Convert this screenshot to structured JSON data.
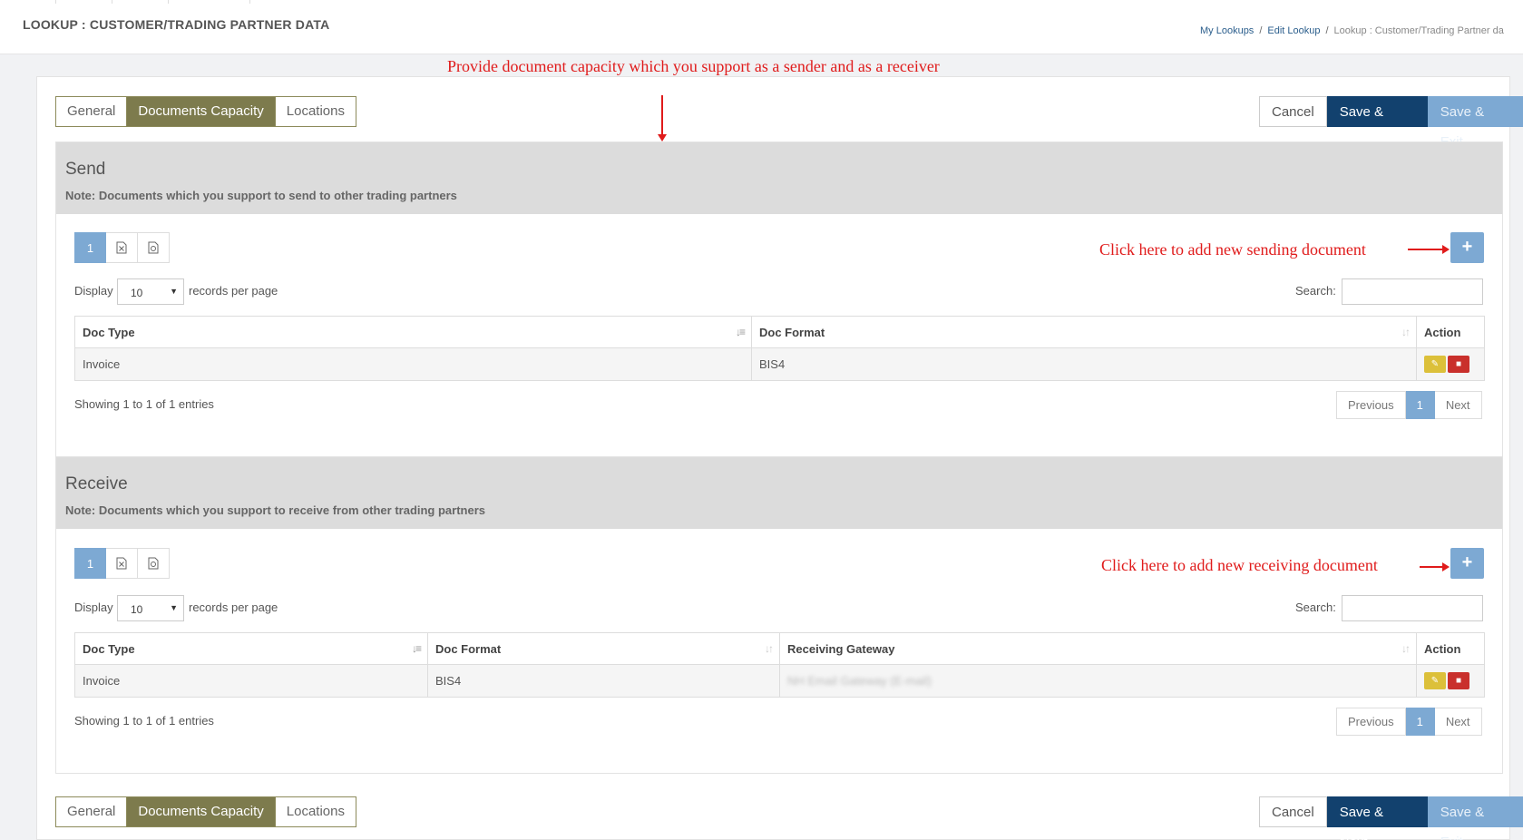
{
  "header": {
    "title": "LOOKUP : CUSTOMER/TRADING PARTNER DATA",
    "breadcrumb": [
      "My Lookups",
      "Edit Lookup",
      "Lookup : Customer/Trading Partner da"
    ]
  },
  "annotations": {
    "top": "Provide document capacity which you support as a sender and as a receiver",
    "send_add": "Click here to add new sending document",
    "receive_add": "Click here to add new receiving document"
  },
  "tabs": [
    "General",
    "Documents Capacity",
    "Locations"
  ],
  "actions": {
    "cancel": "Cancel",
    "save_next": "Save & Next",
    "save_exit": "Save & Exit"
  },
  "send": {
    "title": "Send",
    "note": "Note: Documents which you support to send to other trading partners",
    "page": "1",
    "display_label": "Display",
    "per_page": "10",
    "records_label": "records per page",
    "search_label": "Search:",
    "columns": [
      "Doc Type",
      "Doc Format",
      "Action"
    ],
    "rows": [
      {
        "doc_type": "Invoice",
        "doc_format": "BIS4"
      }
    ],
    "showing": "Showing 1 to 1 of 1 entries",
    "pager": {
      "prev": "Previous",
      "current": "1",
      "next": "Next"
    }
  },
  "receive": {
    "title": "Receive",
    "note": "Note: Documents which you support to receive from other trading partners",
    "page": "1",
    "display_label": "Display",
    "per_page": "10",
    "records_label": "records per page",
    "search_label": "Search:",
    "columns": [
      "Doc Type",
      "Doc Format",
      "Receiving Gateway",
      "Action"
    ],
    "rows": [
      {
        "doc_type": "Invoice",
        "doc_format": "BIS4",
        "gateway": "NH Email Gateway (E-mail)"
      }
    ],
    "showing": "Showing 1 to 1 of 1 entries",
    "pager": {
      "prev": "Previous",
      "current": "1",
      "next": "Next"
    }
  },
  "icons": {
    "excel": "excel-export-icon",
    "csv": "csv-export-icon",
    "edit": "edit-icon",
    "delete": "trash-icon",
    "add": "plus-icon",
    "sort": "sort-icon"
  }
}
